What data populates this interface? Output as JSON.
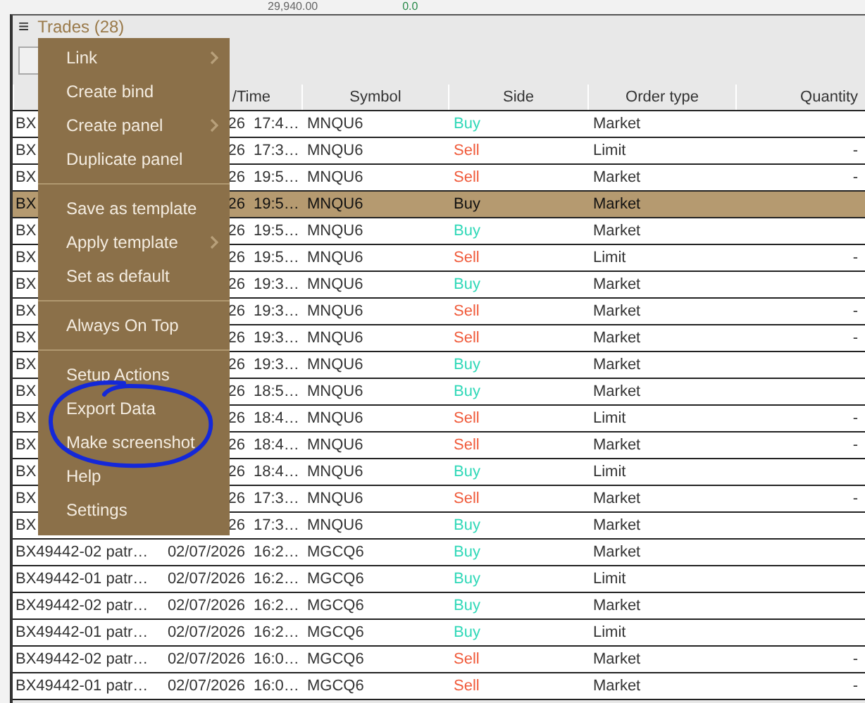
{
  "background": {
    "texts": [
      "29,940.00",
      "0.0"
    ]
  },
  "panel": {
    "menu_icon": "≡",
    "title": "Trades (28)"
  },
  "table": {
    "columns": [
      "",
      "/Time",
      "Symbol",
      "Side",
      "Order type",
      "Quantity"
    ],
    "rows": [
      {
        "account": "BX",
        "date": "26",
        "time": "17:4…",
        "symbol": "MNQU6",
        "side": "Buy",
        "kind": "buy",
        "order_type": "Market",
        "selected": false
      },
      {
        "account": "BX",
        "date": "26",
        "time": "17:3…",
        "symbol": "MNQU6",
        "side": "Sell",
        "kind": "sell",
        "order_type": "Limit",
        "quantity": "-",
        "selected": false
      },
      {
        "account": "BX",
        "date": "26",
        "time": "19:5…",
        "symbol": "MNQU6",
        "side": "Sell",
        "kind": "sell",
        "order_type": "Market",
        "quantity": "-",
        "selected": false
      },
      {
        "account": "BX",
        "date": "26",
        "time": "19:5…",
        "symbol": "MNQU6",
        "side": "Buy",
        "kind": "buy",
        "order_type": "Market",
        "selected": true
      },
      {
        "account": "BX",
        "date": "26",
        "time": "19:5…",
        "symbol": "MNQU6",
        "side": "Buy",
        "kind": "buy",
        "order_type": "Market",
        "selected": false
      },
      {
        "account": "BX",
        "date": "26",
        "time": "19:5…",
        "symbol": "MNQU6",
        "side": "Sell",
        "kind": "sell",
        "order_type": "Limit",
        "quantity": "-",
        "selected": false
      },
      {
        "account": "BX",
        "date": "26",
        "time": "19:3…",
        "symbol": "MNQU6",
        "side": "Buy",
        "kind": "buy",
        "order_type": "Market",
        "selected": false
      },
      {
        "account": "BX",
        "date": "26",
        "time": "19:3…",
        "symbol": "MNQU6",
        "side": "Sell",
        "kind": "sell",
        "order_type": "Market",
        "quantity": "-",
        "selected": false
      },
      {
        "account": "BX",
        "date": "26",
        "time": "19:3…",
        "symbol": "MNQU6",
        "side": "Sell",
        "kind": "sell",
        "order_type": "Market",
        "quantity": "-",
        "selected": false
      },
      {
        "account": "BX",
        "date": "26",
        "time": "19:3…",
        "symbol": "MNQU6",
        "side": "Buy",
        "kind": "buy",
        "order_type": "Market",
        "selected": false
      },
      {
        "account": "BX",
        "date": "26",
        "time": "18:5…",
        "symbol": "MNQU6",
        "side": "Buy",
        "kind": "buy",
        "order_type": "Market",
        "selected": false
      },
      {
        "account": "BX",
        "date": "26",
        "time": "18:4…",
        "symbol": "MNQU6",
        "side": "Sell",
        "kind": "sell",
        "order_type": "Limit",
        "quantity": "-",
        "selected": false
      },
      {
        "account": "BX",
        "date": "26",
        "time": "18:4…",
        "symbol": "MNQU6",
        "side": "Sell",
        "kind": "sell",
        "order_type": "Market",
        "quantity": "-",
        "selected": false
      },
      {
        "account": "BX",
        "date": "26",
        "time": "18:4…",
        "symbol": "MNQU6",
        "side": "Buy",
        "kind": "buy",
        "order_type": "Limit",
        "selected": false
      },
      {
        "account": "BX",
        "date": "26",
        "time": "17:3…",
        "symbol": "MNQU6",
        "side": "Sell",
        "kind": "sell",
        "order_type": "Market",
        "quantity": "-",
        "selected": false
      },
      {
        "account": "BX",
        "date": "26",
        "time": "17:3…",
        "symbol": "MNQU6",
        "side": "Buy",
        "kind": "buy",
        "order_type": "Market",
        "selected": false
      },
      {
        "account": "BX49442-02 patr…",
        "date": "02/07/2026",
        "time": "16:2…",
        "symbol": "MGCQ6",
        "side": "Buy",
        "kind": "buy",
        "order_type": "Market",
        "selected": false
      },
      {
        "account": "BX49442-01 patr…",
        "date": "02/07/2026",
        "time": "16:2…",
        "symbol": "MGCQ6",
        "side": "Buy",
        "kind": "buy",
        "order_type": "Limit",
        "selected": false
      },
      {
        "account": "BX49442-02 patr…",
        "date": "02/07/2026",
        "time": "16:2…",
        "symbol": "MGCQ6",
        "side": "Buy",
        "kind": "buy",
        "order_type": "Market",
        "selected": false
      },
      {
        "account": "BX49442-01 patr…",
        "date": "02/07/2026",
        "time": "16:2…",
        "symbol": "MGCQ6",
        "side": "Buy",
        "kind": "buy",
        "order_type": "Limit",
        "selected": false
      },
      {
        "account": "BX49442-02 patr…",
        "date": "02/07/2026",
        "time": "16:0…",
        "symbol": "MGCQ6",
        "side": "Sell",
        "kind": "sell",
        "order_type": "Market",
        "quantity": "-",
        "selected": false
      },
      {
        "account": "BX49442-01 patr…",
        "date": "02/07/2026",
        "time": "16:0…",
        "symbol": "MGCQ6",
        "side": "Sell",
        "kind": "sell",
        "order_type": "Market",
        "quantity": "-",
        "selected": false
      }
    ]
  },
  "context_menu": {
    "groups": [
      [
        {
          "label": "Link",
          "submenu": true
        },
        {
          "label": "Create bind",
          "submenu": false
        },
        {
          "label": "Create panel",
          "submenu": true
        },
        {
          "label": "Duplicate panel",
          "submenu": false
        }
      ],
      [
        {
          "label": "Save as template",
          "submenu": false
        },
        {
          "label": "Apply template",
          "submenu": true
        },
        {
          "label": "Set as default",
          "submenu": false
        }
      ],
      [
        {
          "label": "Always On Top",
          "submenu": false
        }
      ],
      [
        {
          "label": "Setup Actions",
          "submenu": false
        },
        {
          "label": "Export Data",
          "submenu": false
        },
        {
          "label": "Make screenshot",
          "submenu": false
        },
        {
          "label": "Help",
          "submenu": false
        },
        {
          "label": "Settings",
          "submenu": false
        }
      ]
    ]
  }
}
